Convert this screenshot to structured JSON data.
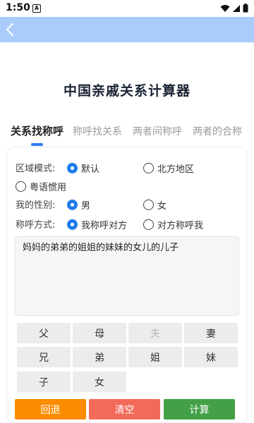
{
  "status": {
    "time": "1:50",
    "a_icon": "A"
  },
  "appbar": {
    "back_icon": "chevron-left-icon"
  },
  "title": "中国亲戚关系计算器",
  "tabs": [
    {
      "label": "关系找称呼",
      "active": true
    },
    {
      "label": "称呼找关系",
      "active": false
    },
    {
      "label": "两者间称呼",
      "active": false
    },
    {
      "label": "两者的合称",
      "active": false
    }
  ],
  "form": {
    "region": {
      "label": "区域模式:",
      "options": [
        "默认",
        "北方地区",
        "粤语惯用"
      ],
      "selected": "默认"
    },
    "gender": {
      "label": "我的性别:",
      "options": [
        "男",
        "女"
      ],
      "selected": "男"
    },
    "mode": {
      "label": "称呼方式:",
      "options": [
        "我称呼对方",
        "对方称呼我"
      ],
      "selected": "我称呼对方"
    }
  },
  "input_text": "妈妈的弟弟的姐姐的妹妹的女儿的儿子",
  "keys": [
    {
      "label": "父",
      "enabled": true
    },
    {
      "label": "母",
      "enabled": true
    },
    {
      "label": "夫",
      "enabled": false
    },
    {
      "label": "妻",
      "enabled": true
    },
    {
      "label": "兄",
      "enabled": true
    },
    {
      "label": "弟",
      "enabled": true
    },
    {
      "label": "姐",
      "enabled": true
    },
    {
      "label": "妹",
      "enabled": true
    },
    {
      "label": "子",
      "enabled": true
    },
    {
      "label": "女",
      "enabled": true
    }
  ],
  "actions": {
    "back": {
      "label": "回退",
      "color": "#fb8c00"
    },
    "clear": {
      "label": "清空",
      "color": "#f26a5a"
    },
    "calc": {
      "label": "计算",
      "color": "#43a047"
    }
  },
  "colors": {
    "accent": "#1e7ce8",
    "appbar": "#a9ccfb",
    "tab_indicator": "#2f7bf5"
  }
}
